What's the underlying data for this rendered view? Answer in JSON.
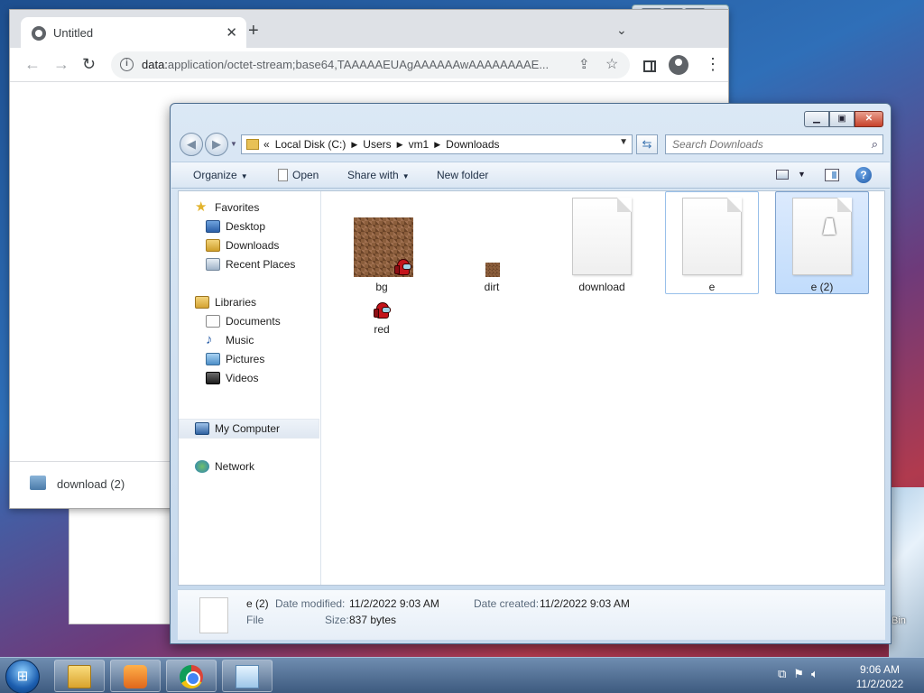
{
  "desktop": {
    "recycle_bin_partial": "Bin"
  },
  "chrome": {
    "tab_title": "Untitled",
    "address_scheme": "data:",
    "address_rest": "application/octet-stream;base64,TAAAAAEUAgAAAAAAwAAAAAAAAE...",
    "download_item": "download (2)"
  },
  "explorer": {
    "breadcrumb": [
      "«",
      "Local Disk (C:)",
      "Users",
      "vm1",
      "Downloads"
    ],
    "search_placeholder": "Search Downloads",
    "commands": {
      "organize": "Organize",
      "open": "Open",
      "share_with": "Share with",
      "new_folder": "New folder"
    },
    "nav": {
      "favorites": "Favorites",
      "desktop": "Desktop",
      "downloads": "Downloads",
      "recent_places": "Recent Places",
      "libraries": "Libraries",
      "documents": "Documents",
      "music": "Music",
      "pictures": "Pictures",
      "videos": "Videos",
      "my_computer": "My Computer",
      "network": "Network"
    },
    "files": [
      {
        "name": "bg",
        "kind": "image"
      },
      {
        "name": "dirt",
        "kind": "image"
      },
      {
        "name": "download",
        "kind": "file"
      },
      {
        "name": "e",
        "kind": "file"
      },
      {
        "name": "e (2)",
        "kind": "file",
        "selected": true
      },
      {
        "name": "red",
        "kind": "image"
      }
    ],
    "details": {
      "name": "e (2)",
      "type": "File",
      "date_modified_label": "Date modified:",
      "date_modified": "11/2/2022 9:03 AM",
      "date_created_label": "Date created:",
      "date_created": "11/2/2022 9:03 AM",
      "size_label": "Size:",
      "size": "837 bytes"
    }
  },
  "taskbar": {
    "time": "9:06 AM",
    "date": "11/2/2022"
  },
  "colors": {
    "selection": "#c1dcfc",
    "selection_border": "#7da2ce",
    "close_button": "#c7412a"
  }
}
